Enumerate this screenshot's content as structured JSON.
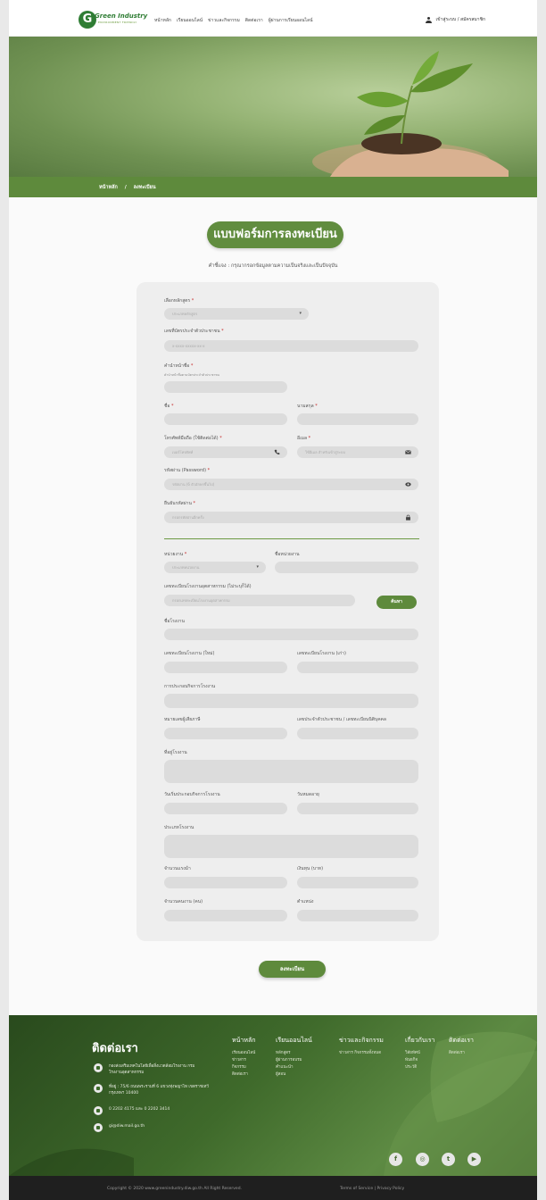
{
  "header": {
    "logo_text": "Green Industry",
    "logo_tagline": "ENVIRONMENT FRIENDLY",
    "nav": [
      "หน้าหลัก",
      "เรียนออนไลน์",
      "ข่าวและกิจกรรม",
      "ติดต่อเรา",
      "ผู้ผ่านการเรียนออนไลน์"
    ],
    "user_link": "เข้าสู่ระบบ / สมัครสมาชิก"
  },
  "breadcrumb": {
    "home": "หน้าหลัก",
    "sep": "/",
    "current": "ลงทะเบียน"
  },
  "form": {
    "title": "แบบฟอร์มการลงทะเบียน",
    "instruction": "คำชี้แจง : กรุณากรอกข้อมูลตามความเป็นจริงและเป็นปัจจุบัน",
    "course_label": "เลือกหลักสูตร",
    "course_value": "ประเภทหลักสูตร",
    "idcard_label": "เลขที่บัตรประจำตัวประชาชน",
    "idcard_placeholder": "x-xxxx-xxxxx-xx-x",
    "prefix_label": "คำนำหน้าชื่อ",
    "prefix_hint": "คำนำหน้าชื่อตามบัตรประจำตัวประชาชน",
    "firstname_label": "ชื่อ",
    "lastname_label": "นามสกุล",
    "mobile_label": "โทรศัพท์มือถือ (ใช้ติดต่อได้)",
    "mobile_placeholder": "เบอร์โทรศัพท์",
    "email_label": "อีเมล",
    "email_placeholder": "ใช้อีเมล สำหรับเข้าสู่ระบบ",
    "password_label": "รหัสผ่าน (Password)",
    "password_placeholder": "รหัสผ่าน (6 ตัวอักษรขึ้นไป)",
    "confirm_label": "ยืนยันรหัสผ่าน",
    "confirm_placeholder": "กรอกรหัสผ่านอีกครั้ง",
    "org_label": "หน่วยงาน",
    "org_value": "ประเภทหน่วยงาน",
    "orgname_label": "ชื่อหน่วยงาน",
    "factoryreg_label": "เลขทะเบียนโรงงานอุตสาหกรรม (ไม่ระบุก็ได้)",
    "factoryreg_placeholder": "กรอกเลขทะเบียนโรงงานอุตสาหกรรม",
    "search_button": "ค้นหา",
    "factoryname_label": "ชื่อโรงงาน",
    "regnew_label": "เลขทะเบียนโรงงาน (ใหม่)",
    "regold_label": "เลขทะเบียนโรงงาน (เก่า)",
    "business_label": "การประกอบกิจการโรงงาน",
    "taxid_label": "หมายเลขผู้เสียภาษี",
    "juristic_label": "เลขประจำตัวประชาชน / เลขทะเบียนนิติบุคคล",
    "address_label": "ที่อยู่โรงงาน",
    "startdate_label": "วันเริ่มประกอบกิจการโรงงาน",
    "expire_label": "วันหมดอายุ",
    "factorytype_label": "ประเภทโรงงาน",
    "horsepower_label": "จำนวนแรงม้า",
    "capital_label": "เงินทุน (บาท)",
    "workers_label": "จำนวนคนงาน (คน)",
    "position_label": "ตำแหน่ง",
    "submit_button": "ลงทะเบียน",
    "required_mark": "*"
  },
  "footer": {
    "contact_title": "ติดต่อเรา",
    "contact_rows": [
      "กองส่งเสริมเทคโนโลยีเพื่อสิ่งแวดล้อมโรงงาน กรมโรงงานอุตสาหกรรม",
      "ที่อยู่ : 75/6 ถนนพระรามที่ 6 แขวงทุ่งพญาไท เขตราชเทวี กรุงเทพฯ 10400",
      "0 2202 4175 และ 0 2202 3414",
      "gi@diw.mail.go.th"
    ],
    "columns": [
      {
        "title": "หน้าหลัก",
        "items": [
          "เรียนออนไลน์",
          "ข่าวสาร",
          "กิจกรรม",
          "ติดต่อเรา"
        ]
      },
      {
        "title": "เรียนออนไลน์",
        "items": [
          "หลักสูตร",
          "ผู้ผ่านการอบรม",
          "คำแนะนำ",
          "ผู้สอน"
        ]
      },
      {
        "title": "ข่าวและกิจกรรม",
        "items": [
          "ข่าวสาร กิจกรรมทั้งหมด"
        ]
      },
      {
        "title": "เกี่ยวกับเรา",
        "items": [
          "วิสัยทัศน์",
          "พันธกิจ",
          "ประวัติ"
        ]
      },
      {
        "title": "ติดต่อเรา",
        "items": [
          "ติดต่อเรา"
        ]
      }
    ],
    "social": [
      "f",
      "◎",
      "t",
      "▶"
    ],
    "copyright": "Copyright © 2020 www.greenindustry.diw.go.th All Right Reserved.",
    "terms": "Terms of Service | Privacy Policy"
  }
}
